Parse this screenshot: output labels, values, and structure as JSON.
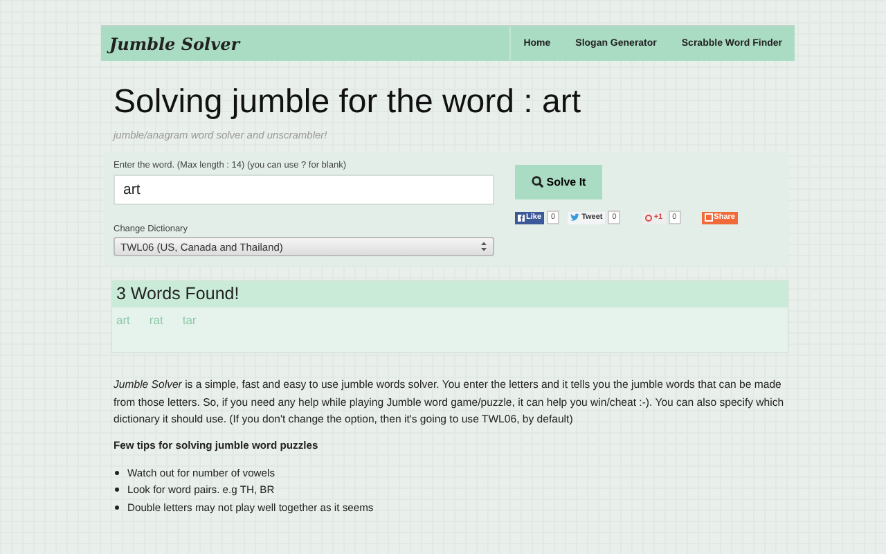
{
  "header": {
    "logo": "Jumble Solver",
    "nav": [
      {
        "label": "Home"
      },
      {
        "label": "Slogan Generator"
      },
      {
        "label": "Scrabble Word Finder"
      }
    ]
  },
  "title": "Solving jumble for the word : art",
  "subtitle": "jumble/anagram word solver and unscrambler!",
  "form": {
    "word_label": "Enter the word. (Max length : 14) (you can use ? for blank)",
    "word_value": "art",
    "solve_button": "Solve It",
    "dictionary_label": "Change Dictionary",
    "dictionary_value": "TWL06 (US, Canada and Thailand)",
    "social": [
      {
        "kind": "facebook",
        "label": "Like",
        "count": "0"
      },
      {
        "kind": "twitter",
        "label": "Tweet",
        "count": "0"
      },
      {
        "kind": "gplus",
        "label": "+1",
        "count": "0"
      },
      {
        "kind": "share",
        "label": "Share"
      }
    ]
  },
  "results": {
    "heading": "3 Words Found!",
    "words": [
      "art",
      "rat",
      "tar"
    ]
  },
  "description": "*Jumble Solver* is a simple, fast and easy to use jumble words solver. You enter the letters and it tells you the jumble words that can be made from those letters. So, if you need any help while playing Jumble word game/puzzle, it can help you win/cheat :-). You can also specify which dictionary it should use. (If you don't change the option, then it's going to use TWL06, by default)",
  "tips": {
    "heading": "Few tips for solving jumble word puzzles",
    "items": [
      "Watch out for number of vowels",
      "Look for word pairs. e.g TH, BR",
      "Double letters may not play well together as it seems"
    ]
  }
}
